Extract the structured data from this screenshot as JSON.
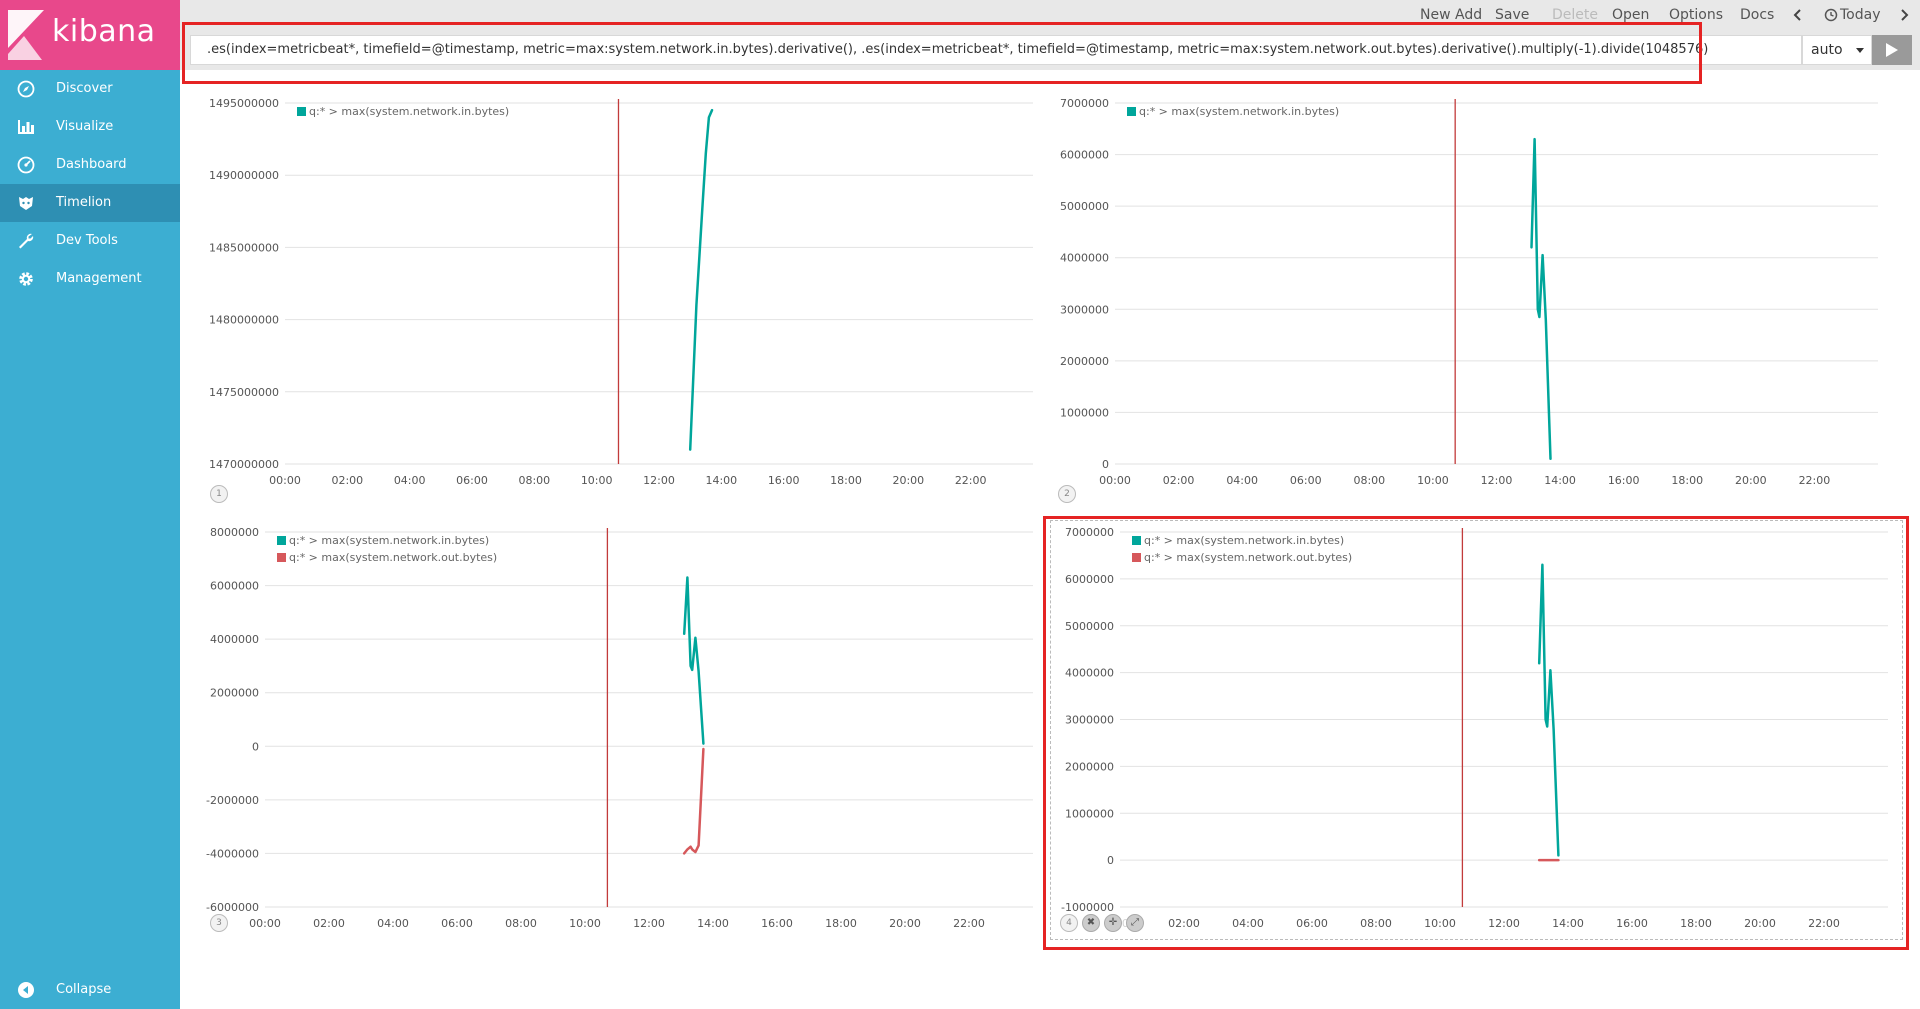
{
  "app": {
    "name": "kibana"
  },
  "sidebar": {
    "items": [
      {
        "label": "Discover",
        "icon": "compass-icon"
      },
      {
        "label": "Visualize",
        "icon": "bar-chart-icon"
      },
      {
        "label": "Dashboard",
        "icon": "dashboard-icon"
      },
      {
        "label": "Timelion",
        "icon": "timelion-icon",
        "active": true
      },
      {
        "label": "Dev Tools",
        "icon": "wrench-icon"
      },
      {
        "label": "Management",
        "icon": "gear-icon"
      }
    ],
    "collapse_label": "Collapse",
    "bg_color": "#3caed2",
    "active_color": "#2e8fb3",
    "logo_color": "#e8488b"
  },
  "topmenu": {
    "new": "New",
    "add": "Add",
    "save": "Save",
    "delete": "Delete",
    "open": "Open",
    "options": "Options",
    "docs": "Docs",
    "time_range": "Today"
  },
  "expression": {
    "value": ".es(index=metricbeat*, timefield=@timestamp, metric=max:system.network.in.bytes).derivative(), .es(index=metricbeat*, timefield=@timestamp, metric=max:system.network.out.bytes).derivative().multiply(-1).divide(1048576)",
    "interval": "auto"
  },
  "colors": {
    "series_in": "#00a69b",
    "series_out": "#d6585b",
    "now_marker": "#c23b3b"
  },
  "panels": [
    {
      "number": "1",
      "legend": [
        "q:* > max(system.network.in.bytes)"
      ],
      "y_ticks": [
        "1495000000",
        "1490000000",
        "1485000000",
        "1480000000",
        "1475000000",
        "1470000000"
      ],
      "x_ticks": [
        "00:00",
        "02:00",
        "04:00",
        "06:00",
        "08:00",
        "10:00",
        "12:00",
        "14:00",
        "16:00",
        "18:00",
        "20:00",
        "22:00"
      ]
    },
    {
      "number": "2",
      "legend": [
        "q:* > max(system.network.in.bytes)"
      ],
      "y_ticks": [
        "7000000",
        "6000000",
        "5000000",
        "4000000",
        "3000000",
        "2000000",
        "1000000",
        "0"
      ],
      "x_ticks": [
        "00:00",
        "02:00",
        "04:00",
        "06:00",
        "08:00",
        "10:00",
        "12:00",
        "14:00",
        "16:00",
        "18:00",
        "20:00",
        "22:00"
      ]
    },
    {
      "number": "3",
      "legend": [
        "q:* > max(system.network.in.bytes)",
        "q:* > max(system.network.out.bytes)"
      ],
      "y_ticks": [
        "8000000",
        "6000000",
        "4000000",
        "2000000",
        "0",
        "-2000000",
        "-4000000",
        "-6000000"
      ],
      "x_ticks": [
        "00:00",
        "02:00",
        "04:00",
        "06:00",
        "08:00",
        "10:00",
        "12:00",
        "14:00",
        "16:00",
        "18:00",
        "20:00",
        "22:00"
      ]
    },
    {
      "number": "4",
      "legend": [
        "q:* > max(system.network.in.bytes)",
        "q:* > max(system.network.out.bytes)"
      ],
      "y_ticks": [
        "7000000",
        "6000000",
        "5000000",
        "4000000",
        "3000000",
        "2000000",
        "1000000",
        "0",
        "-1000000"
      ],
      "x_ticks": [
        "00:00",
        "02:00",
        "04:00",
        "06:00",
        "08:00",
        "10:00",
        "12:00",
        "14:00",
        "16:00",
        "18:00",
        "20:00",
        "22:00"
      ]
    }
  ],
  "chart_data": [
    {
      "type": "line",
      "ylim": [
        1470000000,
        1495000000
      ],
      "series": [
        {
          "name": "q:* > max(system.network.in.bytes)",
          "color": "#00a69b",
          "x": [
            13.0,
            13.2,
            13.4,
            13.5,
            13.6,
            13.7
          ],
          "y": [
            1471000000,
            1481000000,
            1488000000,
            1491500000,
            1494000000,
            1494500000
          ]
        }
      ],
      "now_marker_hour": 10.7
    },
    {
      "type": "line",
      "ylim": [
        0,
        7000000
      ],
      "series": [
        {
          "name": "q:* > max(system.network.in.bytes)",
          "color": "#00a69b",
          "x": [
            13.1,
            13.2,
            13.3,
            13.35,
            13.45,
            13.55,
            13.7
          ],
          "y": [
            4200000,
            6300000,
            3000000,
            2850000,
            4050000,
            2800000,
            100000
          ]
        }
      ],
      "now_marker_hour": 10.7
    },
    {
      "type": "line",
      "ylim": [
        -6000000,
        8000000
      ],
      "series": [
        {
          "name": "q:* > max(system.network.in.bytes)",
          "color": "#00a69b",
          "x": [
            13.1,
            13.2,
            13.3,
            13.35,
            13.45,
            13.55,
            13.7
          ],
          "y": [
            4200000,
            6300000,
            3000000,
            2850000,
            4050000,
            2800000,
            100000
          ]
        },
        {
          "name": "q:* > max(system.network.out.bytes)",
          "color": "#d6585b",
          "x": [
            13.1,
            13.2,
            13.3,
            13.35,
            13.45,
            13.55,
            13.7
          ],
          "y": [
            -4000000,
            -3850000,
            -3750000,
            -3850000,
            -3950000,
            -3700000,
            -100000
          ]
        }
      ],
      "now_marker_hour": 10.7
    },
    {
      "type": "line",
      "ylim": [
        -1000000,
        7000000
      ],
      "series": [
        {
          "name": "q:* > max(system.network.in.bytes)",
          "color": "#00a69b",
          "x": [
            13.1,
            13.2,
            13.3,
            13.35,
            13.45,
            13.55,
            13.7
          ],
          "y": [
            4200000,
            6300000,
            3000000,
            2850000,
            4050000,
            2800000,
            100000
          ]
        },
        {
          "name": "q:* > max(system.network.out.bytes)",
          "color": "#d6585b",
          "x": [
            13.1,
            13.2,
            13.3,
            13.35,
            13.45,
            13.55,
            13.7
          ],
          "y": [
            -5,
            -5,
            -4,
            -4,
            -5,
            -4,
            -1
          ]
        }
      ],
      "now_marker_hour": 10.7
    }
  ]
}
